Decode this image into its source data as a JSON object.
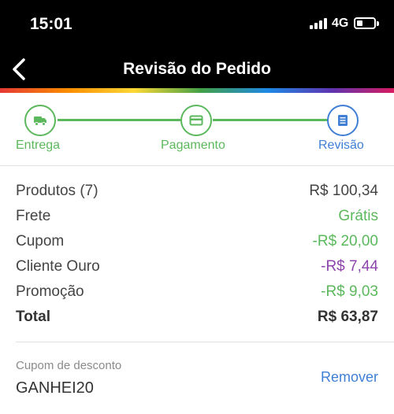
{
  "status_bar": {
    "time": "15:01",
    "network": "4G",
    "icons": [
      "signal-icon",
      "battery-icon"
    ]
  },
  "header": {
    "title": "Revisão do Pedido",
    "back_icon": "chevron-left-icon"
  },
  "colors": {
    "green": "#5cb85c",
    "blue": "#3f7fd6",
    "purple": "#8e44ad",
    "text": "#444444"
  },
  "stepper": {
    "steps": [
      {
        "label": "Entrega",
        "icon": "truck-icon",
        "state": "done"
      },
      {
        "label": "Pagamento",
        "icon": "credit-card-icon",
        "state": "done"
      },
      {
        "label": "Revisão",
        "icon": "list-icon",
        "state": "active"
      }
    ]
  },
  "summary": {
    "rows": [
      {
        "label": "Produtos (7)",
        "value": "R$ 100,34",
        "color": "#444444"
      },
      {
        "label": "Frete",
        "value": "Grátis",
        "color": "#5cb85c"
      },
      {
        "label": "Cupom",
        "value": "-R$ 20,00",
        "color": "#5cb85c"
      },
      {
        "label": "Cliente Ouro",
        "value": "-R$ 7,44",
        "color": "#8e44ad"
      },
      {
        "label": "Promoção",
        "value": "-R$ 9,03",
        "color": "#5cb85c"
      }
    ],
    "total": {
      "label": "Total",
      "value": "R$ 63,87"
    }
  },
  "coupon": {
    "caption": "Cupom de desconto",
    "code": "GANHEI20",
    "remove_label": "Remover"
  }
}
